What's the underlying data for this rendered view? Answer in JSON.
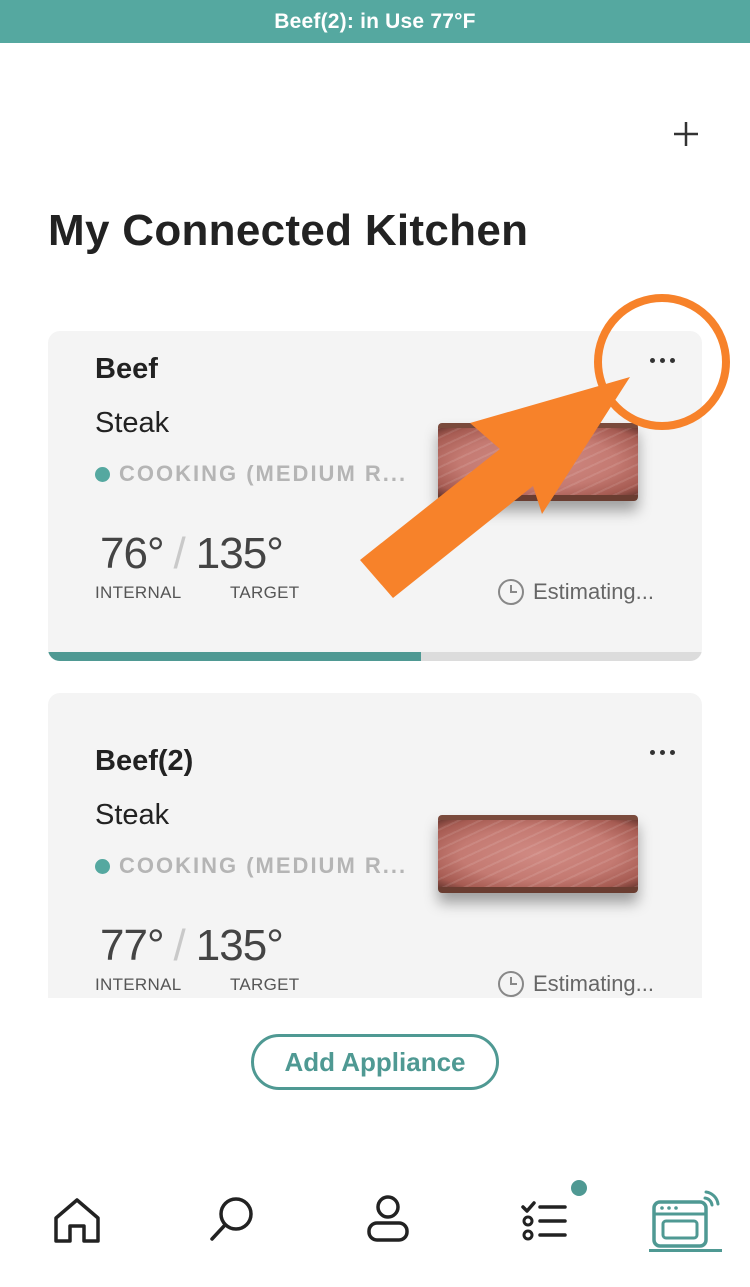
{
  "banner": {
    "text": "Beef(2): in Use 77°F"
  },
  "page": {
    "title": "My Connected Kitchen"
  },
  "cards": [
    {
      "probe_name": "Beef",
      "food": "Steak",
      "status": "COOKING (MEDIUM R...",
      "internal_value": "76°",
      "internal_label": "INTERNAL",
      "target_value": "135°",
      "target_label": "TARGET",
      "time_estimate": "Estimating...",
      "progress_fraction": 0.57
    },
    {
      "probe_name": "Beef(2)",
      "food": "Steak",
      "status": "COOKING (MEDIUM R...",
      "internal_value": "77°",
      "internal_label": "INTERNAL",
      "target_value": "135°",
      "target_label": "TARGET",
      "time_estimate": "Estimating..."
    }
  ],
  "buttons": {
    "add_appliance": "Add Appliance"
  },
  "tabs": [
    {
      "icon": "home-icon"
    },
    {
      "icon": "search-icon"
    },
    {
      "icon": "profile-icon"
    },
    {
      "icon": "checklist-icon",
      "has_notification": true
    },
    {
      "icon": "appliance-icon",
      "selected": true
    }
  ],
  "colors": {
    "accent": "#55a8a0",
    "annotation": "#f7822a"
  }
}
